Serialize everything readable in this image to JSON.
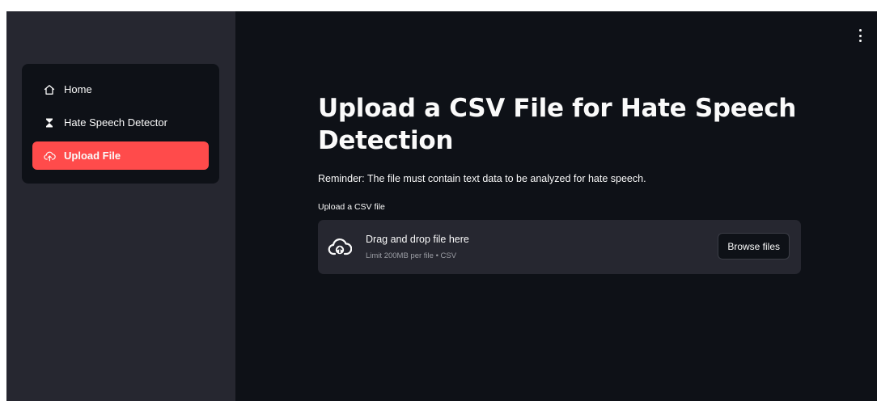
{
  "sidebar": {
    "items": [
      {
        "label": "Home",
        "icon": "house-icon",
        "active": false
      },
      {
        "label": "Hate Speech Detector",
        "icon": "hourglass-icon",
        "active": false
      },
      {
        "label": "Upload File",
        "icon": "cloud-upload-icon",
        "active": true
      }
    ]
  },
  "main": {
    "title": "Upload a CSV File for Hate Speech Detection",
    "reminder": "Reminder: The file must contain text data to be analyzed for hate speech.",
    "uploader": {
      "label": "Upload a CSV file",
      "drop_text": "Drag and drop file here",
      "limit_text": "Limit 200MB per file • CSV",
      "browse_label": "Browse files",
      "icon": "cloud-upload-icon"
    },
    "menu_icon": "vertical-dots-icon"
  },
  "colors": {
    "sidebar_bg": "#262730",
    "main_bg": "#0e1117",
    "accent": "#ff4b4b",
    "text": "#fafafa"
  }
}
